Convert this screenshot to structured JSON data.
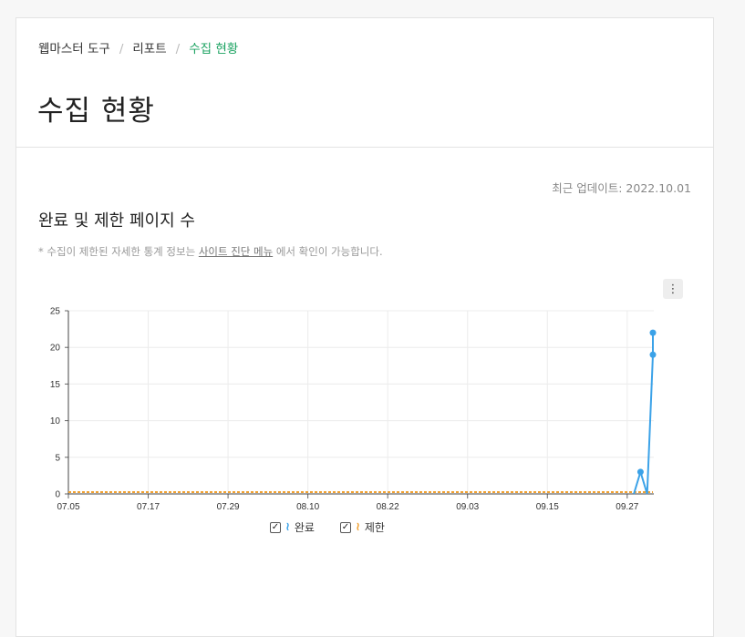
{
  "breadcrumb": {
    "items": [
      "웹마스터 도구",
      "리포트"
    ],
    "current": "수집 현황",
    "separator": "/"
  },
  "page": {
    "title": "수집 현황"
  },
  "updated": "최근 업데이트: 2022.10.01",
  "section": {
    "title": "완료 및 제한 페이지 수",
    "note_prefix": "* 수집이 제한된 자세한 통계 정보는 ",
    "note_link": "사이트 진단 메뉴",
    "note_suffix": " 에서 확인이 가능합니다."
  },
  "menu_icon": "⋮",
  "legend": {
    "check_glyph": "✓",
    "swatch_glyph": "≀",
    "items": [
      {
        "label": "완료",
        "color": "#3ba2e8"
      },
      {
        "label": "제한",
        "color": "#f0a030"
      }
    ]
  },
  "chart_data": {
    "type": "line",
    "x_ticks": [
      "07.05",
      "07.17",
      "07.29",
      "08.10",
      "08.22",
      "09.03",
      "09.15",
      "09.27"
    ],
    "y_ticks": [
      0,
      5,
      10,
      15,
      20,
      25
    ],
    "ylim": [
      0,
      25
    ],
    "xlim": [
      "07.05",
      "10.01"
    ],
    "grid": true,
    "legend_position": "bottom",
    "series": [
      {
        "name": "완료",
        "color": "#3ba2e8",
        "points": [
          [
            "09.28",
            0
          ],
          [
            "09.29",
            3
          ],
          [
            "09.30",
            0
          ],
          [
            "10.01",
            19
          ],
          [
            "10.02",
            22
          ]
        ]
      },
      {
        "name": "제한",
        "color": "#f0a030",
        "points": [
          [
            "07.05",
            0
          ],
          [
            "10.02",
            0
          ]
        ]
      }
    ]
  }
}
